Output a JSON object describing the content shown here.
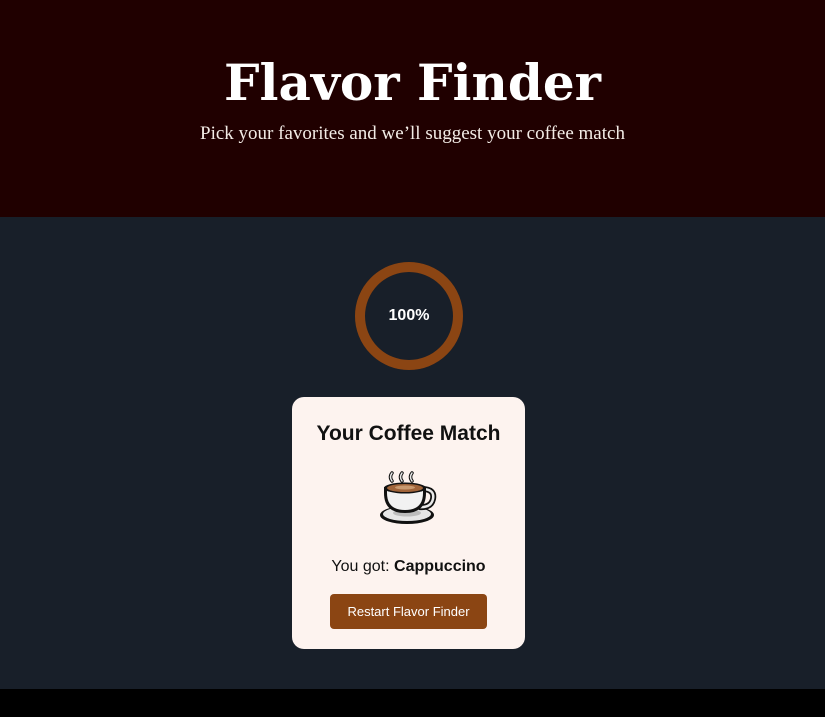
{
  "hero": {
    "title": "Flavor Finder",
    "subtitle": "Pick your favorites and we’ll suggest your coffee match"
  },
  "progress": {
    "label": "100%",
    "value": 1.0,
    "ring_color": "#8b4513"
  },
  "result_card": {
    "title": "Your Coffee Match",
    "icon": "coffee-cup-icon",
    "result_prefix": "You got:",
    "result_value": "Cappuccino",
    "restart_label": "Restart Flavor Finder"
  },
  "colors": {
    "hero_background": "#200000",
    "main_background": "#181f29",
    "card_background": "#fdf3ef",
    "accent": "#8b4513"
  }
}
